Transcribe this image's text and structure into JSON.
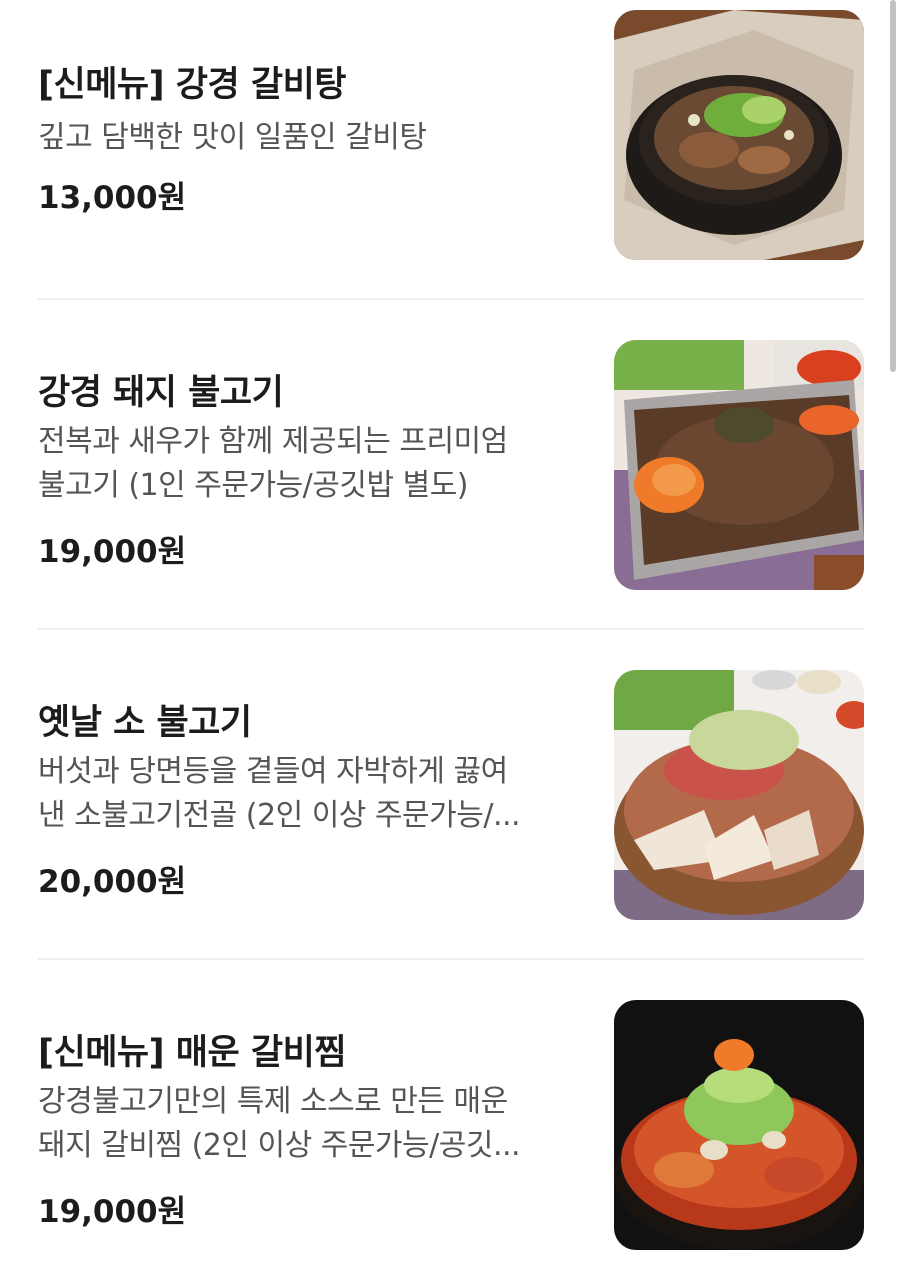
{
  "menu": {
    "items": [
      {
        "name": "[신메뉴] 강경 갈비탕",
        "desc_lines": [
          "깊고 담백한 맛이 일품인 갈비탕"
        ],
        "price": "13,000원",
        "photo_icon": "galbitang-photo"
      },
      {
        "name": "강경 돼지 불고기",
        "desc_lines": [
          "전복과 새우가 함께 제공되는 프리미엄",
          "불고기 (1인 주문가능/공깃밥 별도)"
        ],
        "price": "19,000원",
        "photo_icon": "pork-bulgogi-photo"
      },
      {
        "name": "옛날 소 불고기",
        "desc_lines": [
          "버섯과 당면등을 곁들여 자박하게 끓여",
          "낸 소불고기전골 (2인 이상 주문가능/..."
        ],
        "price": "20,000원",
        "photo_icon": "beef-bulgogi-photo"
      },
      {
        "name": "[신메뉴] 매운 갈비찜",
        "desc_lines": [
          "강경불고기만의 특제 소스로 만든 매운",
          "돼지 갈비찜 (2인 이상 주문가능/공깃..."
        ],
        "price": "19,000원",
        "photo_icon": "spicy-galbijjim-photo"
      }
    ]
  },
  "colors": {
    "text_primary": "#1c1c1c",
    "text_secondary": "#555555",
    "divider": "#eeeeee",
    "scrollbar": "#c2c2c2"
  }
}
